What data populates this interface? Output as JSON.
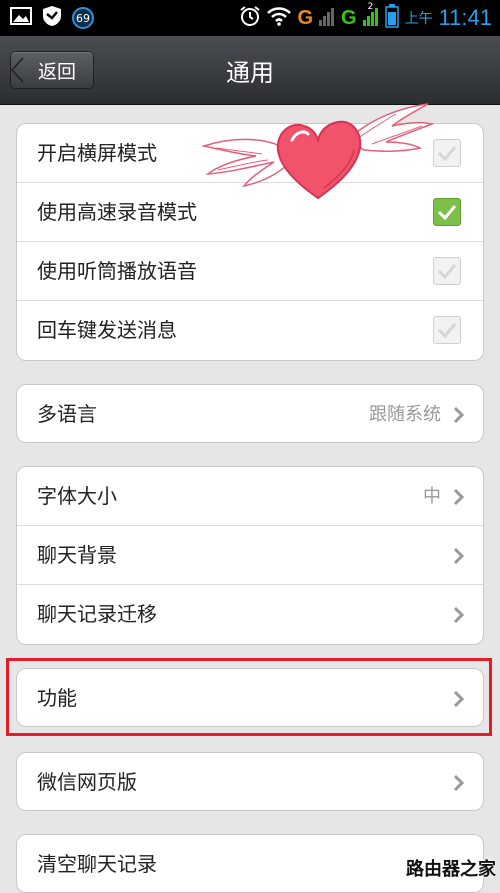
{
  "status_bar": {
    "notification_count": "69",
    "carrier1": "G",
    "carrier2": "G",
    "network_superscript": "2",
    "ampm": "上午",
    "time": "11:41"
  },
  "header": {
    "back_label": "返回",
    "title": "通用"
  },
  "toggles": [
    {
      "label": "开启横屏模式",
      "checked": false
    },
    {
      "label": "使用高速录音模式",
      "checked": true
    },
    {
      "label": "使用听筒播放语音",
      "checked": false
    },
    {
      "label": "回车键发送消息",
      "checked": false
    }
  ],
  "language": {
    "label": "多语言",
    "value": "跟随系统"
  },
  "display": {
    "font_size": {
      "label": "字体大小",
      "value": "中"
    },
    "chat_background": {
      "label": "聊天背景"
    },
    "chat_migration": {
      "label": "聊天记录迁移"
    }
  },
  "features": {
    "label": "功能"
  },
  "web_version": {
    "label": "微信网页版"
  },
  "clear_history": {
    "label": "清空聊天记录"
  },
  "watermark": "路由器之家",
  "colors": {
    "checked_green": "#7cc04a",
    "highlight_red": "#e41c2a",
    "time_blue": "#2a9ee8"
  }
}
